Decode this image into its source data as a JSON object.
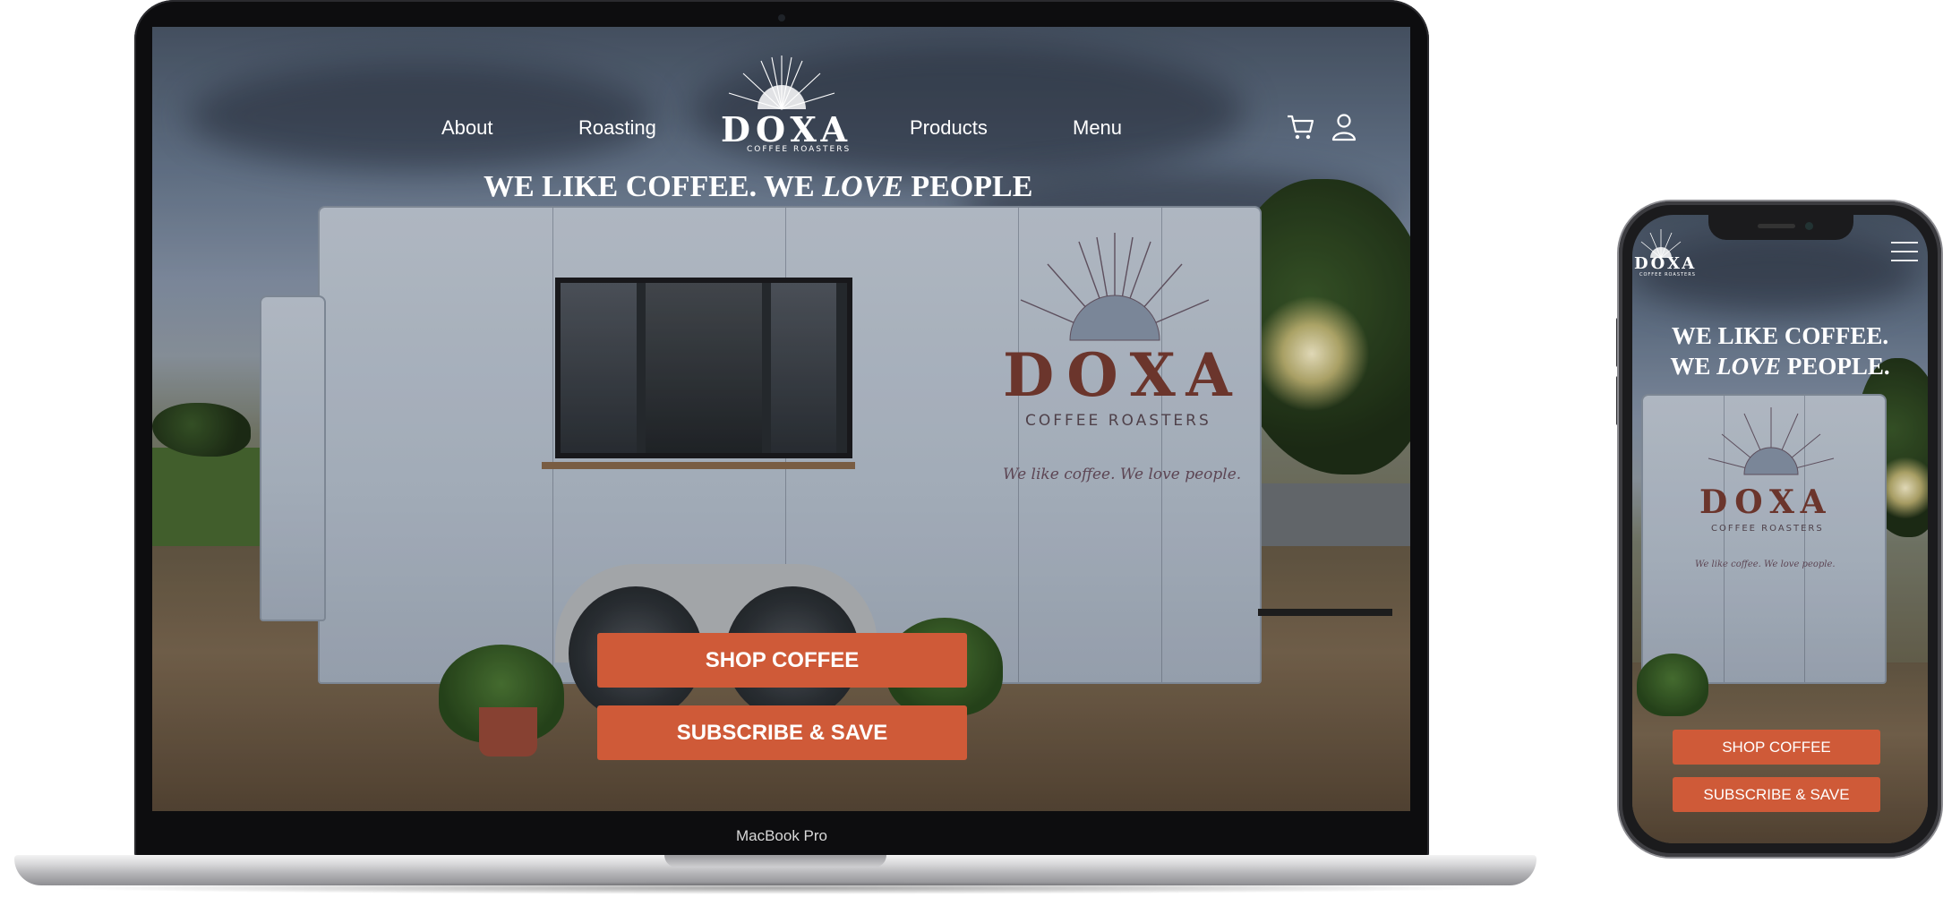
{
  "site": {
    "brand": "DOXA",
    "brand_sub": "COFFEE ROASTERS",
    "nav": {
      "about": "About",
      "roasting": "Roasting",
      "products": "Products",
      "menu": "Menu"
    },
    "hero": {
      "title_part1": "WE LIKE COFFEE. WE ",
      "title_emphasis": "LOVE",
      "title_part2": " PEOPLE",
      "mobile_line1": "WE LIKE COFFEE.",
      "mobile_line2_part1": "WE ",
      "mobile_line2_part2": " PEOPLE."
    },
    "buttons": {
      "shop": "SHOP COFFEE",
      "subscribe": "SUBSCRIBE & SAVE"
    },
    "trailer_tagline": "We like coffee. We love people.",
    "accent_color": "#cf5a38"
  },
  "device": {
    "laptop_label": "MacBook Pro"
  },
  "icons": {
    "cart": "cart-icon",
    "account": "user-icon",
    "menu": "hamburger-icon"
  }
}
